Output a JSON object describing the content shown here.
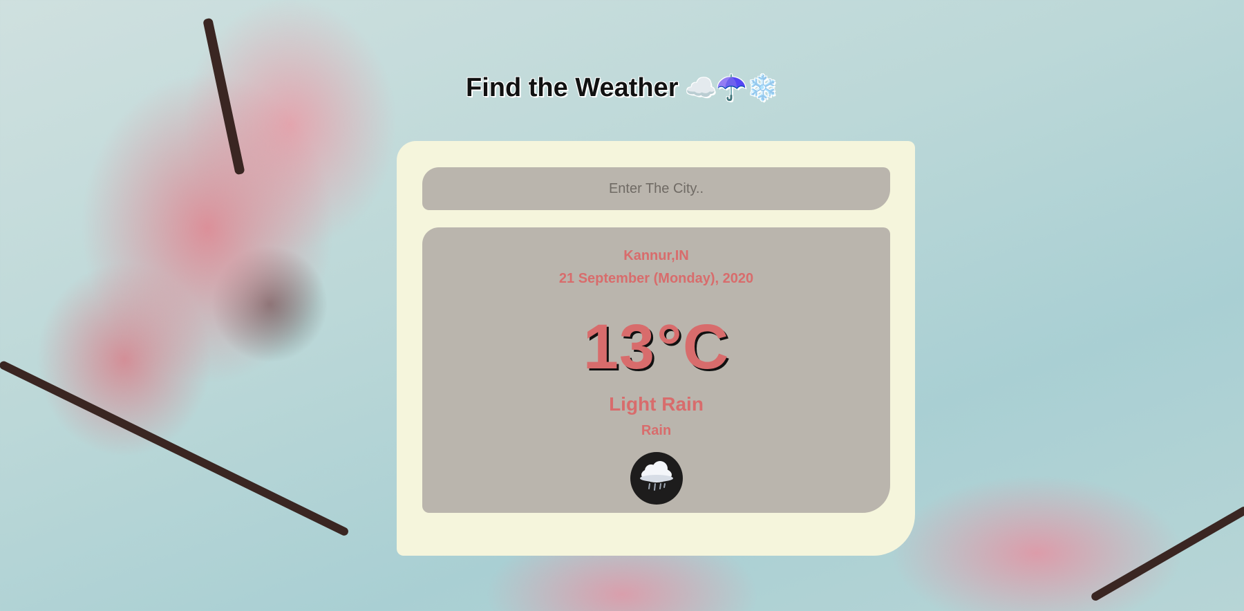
{
  "header": {
    "title": "Find the Weather",
    "title_icons": "☁️☂️❄️"
  },
  "search": {
    "placeholder": "Enter The City..",
    "value": ""
  },
  "weather": {
    "location": "Kannur,IN",
    "date": "21 September (Monday), 2020",
    "temperature": "13",
    "unit": "°C",
    "description": "Light Rain",
    "main": "Rain",
    "icon": "rain-cloud-icon"
  }
}
